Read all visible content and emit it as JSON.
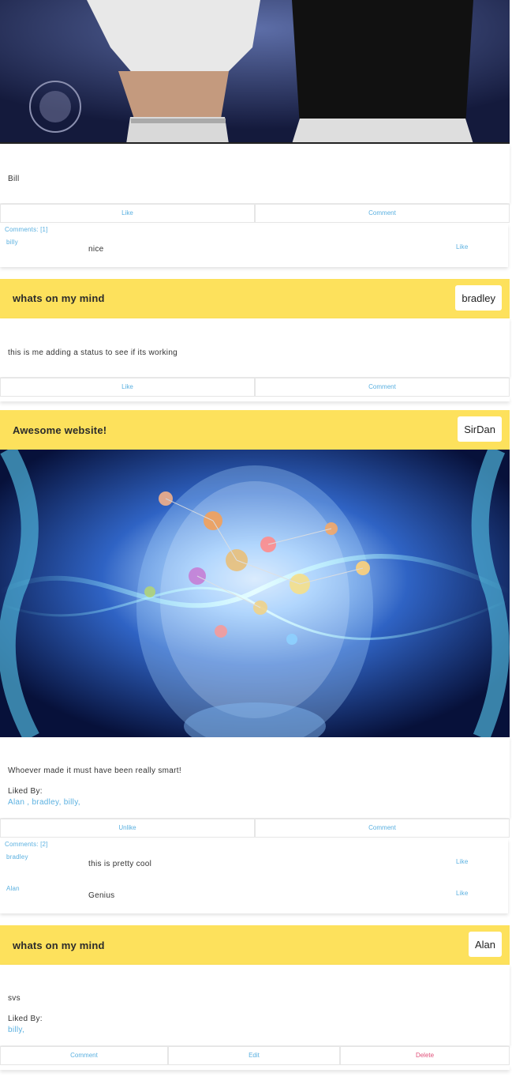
{
  "posts": [
    {
      "title": "",
      "status": "Bill",
      "like_label": "Like",
      "comment_label": "Comment",
      "comments_count_label": "Comments: [1]",
      "comments": [
        {
          "author": "billy",
          "text": "nice",
          "like_label": "Like"
        }
      ]
    },
    {
      "title": "whats on my mind",
      "user": "bradley",
      "status": "this is me adding a status to see if its working",
      "like_label": "Like",
      "comment_label": "Comment"
    },
    {
      "title": "Awesome website!",
      "user": "SirDan",
      "status": "Whoever made it must have been really smart!",
      "liked_by_label": "Liked By:",
      "liked_by": "Alan , bradley, billy,",
      "like_label": "Unlike",
      "comment_label": "Comment",
      "comments_count_label": "Comments: [2]",
      "comments": [
        {
          "author": "bradley",
          "text": "this is pretty cool",
          "like_label": "Like"
        },
        {
          "author": "Alan",
          "text": "Genius",
          "like_label": "Like"
        }
      ]
    },
    {
      "title": "whats on my mind",
      "user": "Alan",
      "status": "svs",
      "liked_by_label": "Liked By:",
      "liked_by": "billy,",
      "comment_label": "Comment",
      "edit_label": "Edit",
      "delete_label": "Delete"
    }
  ],
  "colors": {
    "header_yellow": "#fde15c",
    "link_blue": "#5ab0e0",
    "delete_red": "#e0507a"
  },
  "icons": {
    "post1_image": "concert-photo-image",
    "post3_image": "digital-brain-image"
  }
}
